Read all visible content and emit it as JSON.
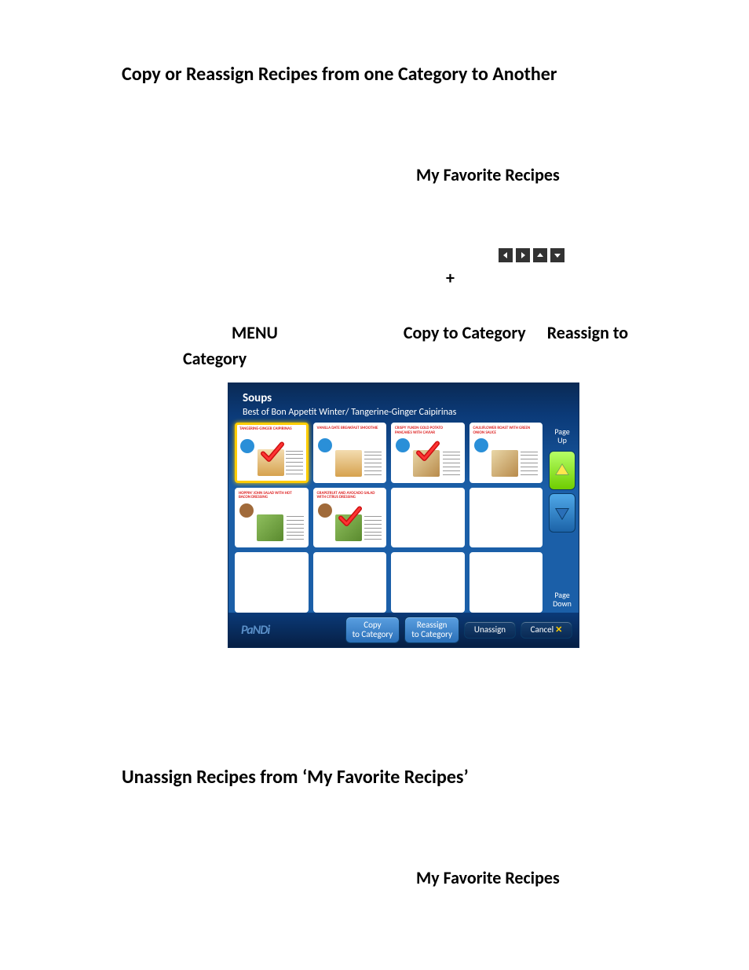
{
  "doc": {
    "heading1": "Copy or Reassign Recipes from one Category to Another",
    "fav_label": "My Favorite Recipes",
    "plus": "+",
    "menu_row": {
      "menu": "MENU",
      "copy": "Copy to Category",
      "reassign": "Reassign to",
      "category": "Category"
    },
    "heading2": "Unassign Recipes from ‘My Favorite Recipes’",
    "fav_label_2": "My Favorite Recipes"
  },
  "panel": {
    "category_name": "Soups",
    "breadcrumb": "Best of Bon Appetit Winter/ Tangerine-Ginger Caipirinas",
    "brand": "PaNDi",
    "sidebar": {
      "page_up": "Page Up",
      "page_down": "Page Down"
    },
    "buttons": {
      "copy": "Copy to Category",
      "reassign": "Reassign to Category",
      "unassign": "Unassign",
      "cancel": "Cancel"
    },
    "tiles": [
      {
        "title": "TANGERINE-GINGER CAIPIRINAS",
        "selected": true,
        "checked": true,
        "has_content": true,
        "style": "drink",
        "badge": "blue"
      },
      {
        "title": "VANILLA DATE BREAKFAST SMOOTHIE",
        "selected": false,
        "checked": false,
        "has_content": true,
        "style": "drink",
        "badge": "blue"
      },
      {
        "title": "CRISPY YUKON GOLD POTATO PANCAKES WITH CAVIAR",
        "selected": false,
        "checked": true,
        "has_content": true,
        "style": "sand",
        "badge": "blue"
      },
      {
        "title": "CAULIFLOWER ROAST WITH GREEN ONION SAUCE",
        "selected": false,
        "checked": false,
        "has_content": true,
        "style": "sand",
        "badge": "blue"
      },
      {
        "title": "HOPPIN' JOHN SALAD WITH HOT BACON DRESSING",
        "selected": false,
        "checked": false,
        "has_content": true,
        "style": "salad",
        "badge": "brown"
      },
      {
        "title": "GRAPEFRUIT AND AVOCADO SALAD WITH CITRUS DRESSING",
        "selected": false,
        "checked": true,
        "has_content": true,
        "style": "salad",
        "badge": "brown"
      },
      {
        "title": "",
        "selected": false,
        "checked": false,
        "has_content": false
      },
      {
        "title": "",
        "selected": false,
        "checked": false,
        "has_content": false
      },
      {
        "title": "",
        "selected": false,
        "checked": false,
        "has_content": false
      },
      {
        "title": "",
        "selected": false,
        "checked": false,
        "has_content": false
      },
      {
        "title": "",
        "selected": false,
        "checked": false,
        "has_content": false
      },
      {
        "title": "",
        "selected": false,
        "checked": false,
        "has_content": false
      }
    ]
  }
}
